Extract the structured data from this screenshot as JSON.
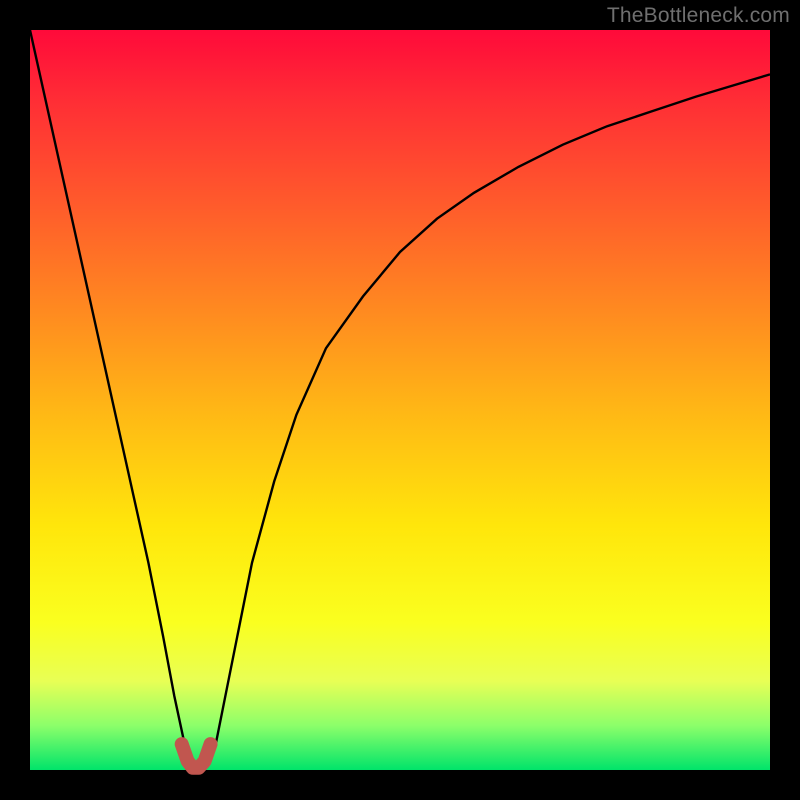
{
  "watermark": "TheBottleneck.com",
  "chart_data": {
    "type": "line",
    "title": "",
    "xlabel": "",
    "ylabel": "",
    "xlim": [
      0,
      100
    ],
    "ylim": [
      0,
      100
    ],
    "grid": false,
    "legend": false,
    "series": [
      {
        "name": "curve",
        "x": [
          0,
          2,
          4,
          6,
          8,
          10,
          12,
          14,
          16,
          18,
          19.5,
          21,
          22,
          23,
          24,
          25,
          26,
          28,
          30,
          33,
          36,
          40,
          45,
          50,
          55,
          60,
          66,
          72,
          78,
          84,
          90,
          95,
          100
        ],
        "y": [
          100,
          91,
          82,
          73,
          64,
          55,
          46,
          37,
          28,
          18,
          10,
          3,
          0.5,
          0,
          0.5,
          3,
          8,
          18,
          28,
          39,
          48,
          57,
          64,
          70,
          74.5,
          78,
          81.5,
          84.5,
          87,
          89,
          91,
          92.5,
          94
        ]
      },
      {
        "name": "highlight-knee",
        "x": [
          20.5,
          21.3,
          22.0,
          22.8,
          23.6,
          24.4
        ],
        "y": [
          3.5,
          1.2,
          0.3,
          0.3,
          1.2,
          3.5
        ]
      }
    ],
    "colors": {
      "curve_stroke": "#000000",
      "highlight_stroke": "#c1564f",
      "gradient_top": "#ff0a3a",
      "gradient_bottom": "#00e46a"
    }
  }
}
